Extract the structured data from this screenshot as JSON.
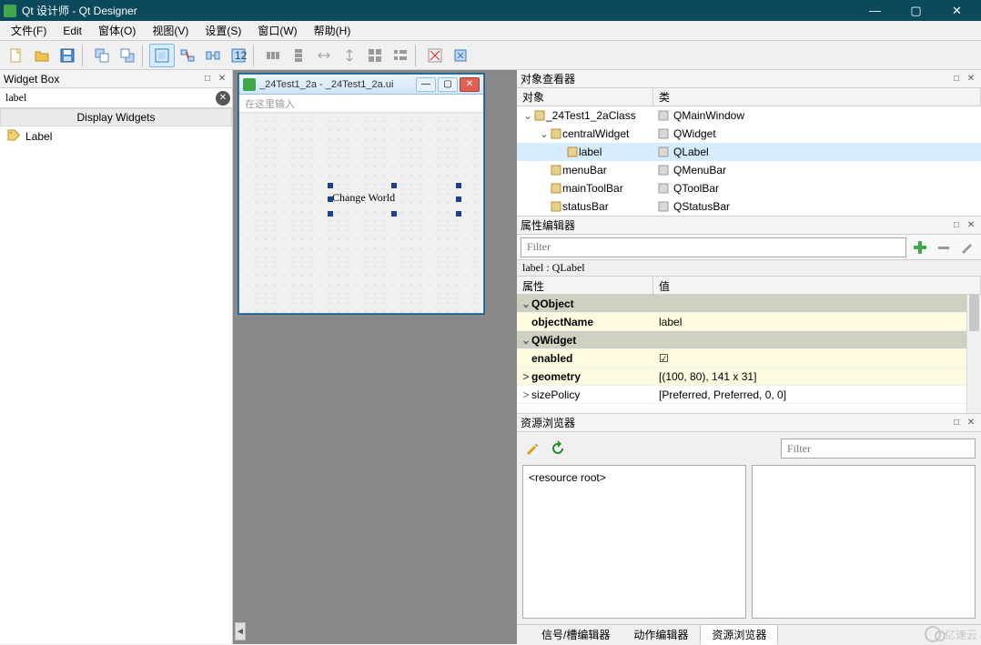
{
  "window": {
    "title": "Qt 设计师 - Qt Designer",
    "min": "—",
    "max": "▢",
    "close": "✕"
  },
  "menu": {
    "file": "文件(F)",
    "edit": "Edit",
    "form": "窗体(O)",
    "view": "视图(V)",
    "settings": "设置(S)",
    "window": "窗口(W)",
    "help": "帮助(H)"
  },
  "widgetbox": {
    "title": "Widget Box",
    "filter": "label",
    "category": "Display Widgets",
    "item": "Label"
  },
  "mdi": {
    "title": "_24Test1_2a - _24Test1_2a.ui",
    "menuHint": "在这里输入",
    "labelText": "Change World"
  },
  "objectInspector": {
    "title": "对象查看器",
    "col1": "对象",
    "col2": "类",
    "rows": [
      {
        "name": "_24Test1_2aClass",
        "cls": "QMainWindow",
        "depth": 0,
        "exp": "v"
      },
      {
        "name": "centralWidget",
        "cls": "QWidget",
        "depth": 1,
        "exp": "v"
      },
      {
        "name": "label",
        "cls": "QLabel",
        "depth": 2,
        "sel": true
      },
      {
        "name": "menuBar",
        "cls": "QMenuBar",
        "depth": 1
      },
      {
        "name": "mainToolBar",
        "cls": "QToolBar",
        "depth": 1
      },
      {
        "name": "statusBar",
        "cls": "QStatusBar",
        "depth": 1
      }
    ]
  },
  "propertyEditor": {
    "title": "属性编辑器",
    "filterPlaceholder": "Filter",
    "infoLabel": "label : QLabel",
    "col1": "属性",
    "col2": "值",
    "rows": [
      {
        "group": "QObject"
      },
      {
        "name": "objectName",
        "val": "label",
        "changed": true
      },
      {
        "group": "QWidget"
      },
      {
        "name": "enabled",
        "val": "☑",
        "changed": true
      },
      {
        "name": "geometry",
        "val": "[(100, 80), 141 x 31]",
        "changed": true,
        "exp": ">"
      },
      {
        "name": "sizePolicy",
        "val": "[Preferred, Preferred, 0, 0]",
        "exp": ">"
      }
    ]
  },
  "resourceBrowser": {
    "title": "资源浏览器",
    "filterPlaceholder": "Filter",
    "root": "<resource root>"
  },
  "bottomTabs": {
    "signal": "信号/槽编辑器",
    "action": "动作编辑器",
    "resource": "资源浏览器"
  },
  "watermark": "亿速云"
}
